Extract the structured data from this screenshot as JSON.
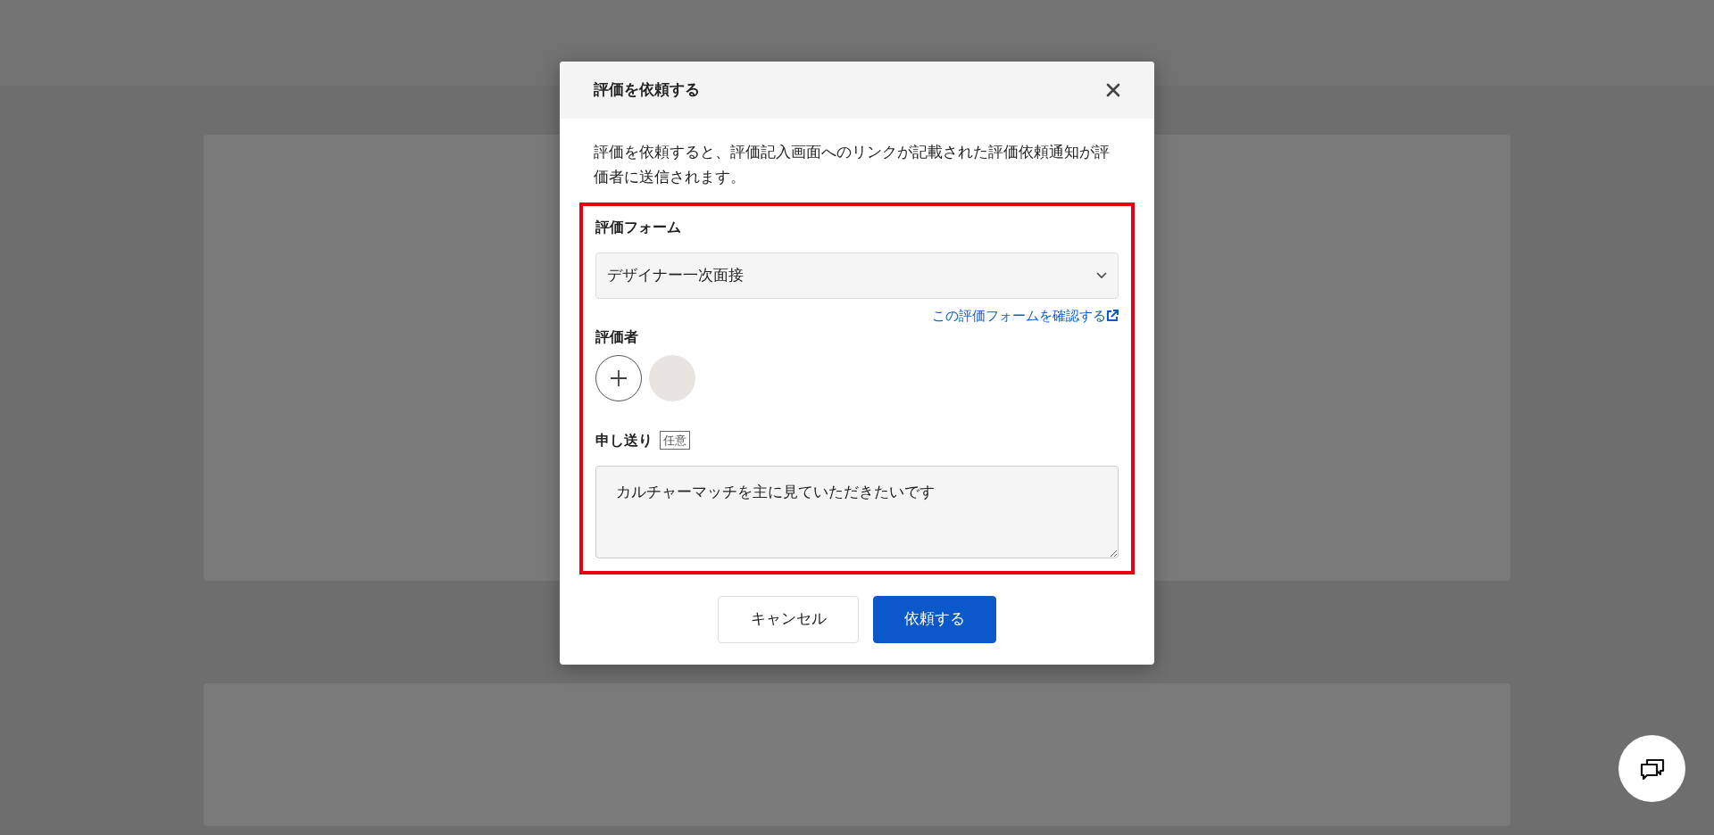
{
  "modal": {
    "title": "評価を依頼する",
    "description": "評価を依頼すると、評価記入画面へのリンクが記載された評価依頼通知が評価者に送信されます。",
    "form_field": {
      "label": "評価フォーム",
      "value": "デザイナー一次面接",
      "link": "この評価フォームを確認する"
    },
    "reviewers": {
      "label": "評価者",
      "people": [
        {
          "kind": "photo"
        }
      ]
    },
    "note": {
      "label": "申し送り",
      "badge": "任意",
      "value": "カルチャーマッチを主に見ていただきたいです"
    },
    "buttons": [
      {
        "label": "キャンセル",
        "kind": "secondary"
      },
      {
        "label": "依頼する",
        "kind": "primary"
      }
    ]
  }
}
